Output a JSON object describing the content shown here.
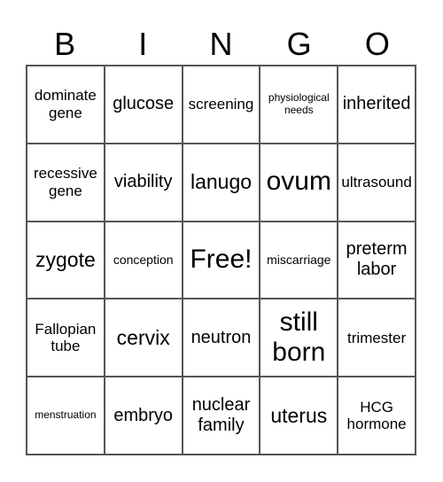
{
  "header": [
    "B",
    "I",
    "N",
    "G",
    "O"
  ],
  "cells": [
    {
      "text": "dominate gene",
      "size": "s-md"
    },
    {
      "text": "glucose",
      "size": "s-lg"
    },
    {
      "text": "screening",
      "size": "s-md"
    },
    {
      "text": "physiological needs",
      "size": "s-xs"
    },
    {
      "text": "inherited",
      "size": "s-lg"
    },
    {
      "text": "recessive gene",
      "size": "s-md"
    },
    {
      "text": "viability",
      "size": "s-lg"
    },
    {
      "text": "lanugo",
      "size": "s-xl"
    },
    {
      "text": "ovum",
      "size": "s-xxl"
    },
    {
      "text": "ultrasound",
      "size": "s-md"
    },
    {
      "text": "zygote",
      "size": "s-xl"
    },
    {
      "text": "conception",
      "size": "s-sm"
    },
    {
      "text": "Free!",
      "size": "s-xxl"
    },
    {
      "text": "miscarriage",
      "size": "s-sm"
    },
    {
      "text": "preterm labor",
      "size": "s-lg"
    },
    {
      "text": "Fallopian tube",
      "size": "s-md"
    },
    {
      "text": "cervix",
      "size": "s-xl"
    },
    {
      "text": "neutron",
      "size": "s-lg"
    },
    {
      "text": "still born",
      "size": "s-xxl"
    },
    {
      "text": "trimester",
      "size": "s-md"
    },
    {
      "text": "menstruation",
      "size": "s-xs"
    },
    {
      "text": "embryo",
      "size": "s-lg"
    },
    {
      "text": "nuclear family",
      "size": "s-lg"
    },
    {
      "text": "uterus",
      "size": "s-xl"
    },
    {
      "text": "HCG hormone",
      "size": "s-md"
    }
  ]
}
